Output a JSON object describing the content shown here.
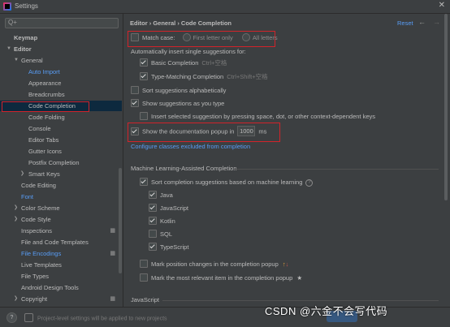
{
  "window": {
    "title": "Settings"
  },
  "sidebar": {
    "search_placeholder": "Q+",
    "items": [
      {
        "label": "Keymap"
      },
      {
        "label": "Editor"
      },
      {
        "label": "General"
      },
      {
        "label": "Auto Import"
      },
      {
        "label": "Appearance"
      },
      {
        "label": "Breadcrumbs"
      },
      {
        "label": "Code Completion"
      },
      {
        "label": "Code Folding"
      },
      {
        "label": "Console"
      },
      {
        "label": "Editor Tabs"
      },
      {
        "label": "Gutter Icons"
      },
      {
        "label": "Postfix Completion"
      },
      {
        "label": "Smart Keys"
      },
      {
        "label": "Code Editing"
      },
      {
        "label": "Font"
      },
      {
        "label": "Color Scheme"
      },
      {
        "label": "Code Style"
      },
      {
        "label": "Inspections"
      },
      {
        "label": "File and Code Templates"
      },
      {
        "label": "File Encodings"
      },
      {
        "label": "Live Templates"
      },
      {
        "label": "File Types"
      },
      {
        "label": "Android Design Tools"
      },
      {
        "label": "Copyright"
      }
    ]
  },
  "main": {
    "breadcrumb": "Editor  ›  General  ›  Code Completion",
    "reset_label": "Reset",
    "match_case_label": "Match case:",
    "first_letter_only": "First letter only",
    "all_letters": "All letters",
    "auto_insert_heading": "Automatically insert single suggestions for:",
    "basic_completion": "Basic Completion",
    "basic_completion_shortcut": "Ctrl+空格",
    "type_matching": "Type-Matching Completion",
    "type_matching_shortcut": "Ctrl+Shift+空格",
    "sort_alpha": "Sort suggestions alphabetically",
    "show_as_you_type": "Show suggestions as you type",
    "insert_selected": "Insert selected suggestion by pressing space, dot, or other context-dependent keys",
    "show_doc_popup": "Show the documentation popup in",
    "popup_delay_value": "1000",
    "popup_delay_unit": "ms",
    "configure_link": "Configure classes excluded from completion",
    "ml_heading": "Machine Learning-Assisted Completion",
    "sort_ml": "Sort completion suggestions based on machine learning",
    "languages": [
      "Java",
      "JavaScript",
      "Kotlin",
      "SQL",
      "TypeScript"
    ],
    "mark_position_changes": "Mark position changes in the completion popup",
    "mark_most_relevant": "Mark the most relevant item in the completion popup",
    "javascript_section": "JavaScript"
  },
  "footer": {
    "notice": "Project-level settings will be applied to new projects"
  },
  "watermark": "CSDN @六金不会写代码",
  "colors": {
    "accent": "#589df6",
    "highlight_box": "#d2232a",
    "selection": "#0d293e"
  }
}
